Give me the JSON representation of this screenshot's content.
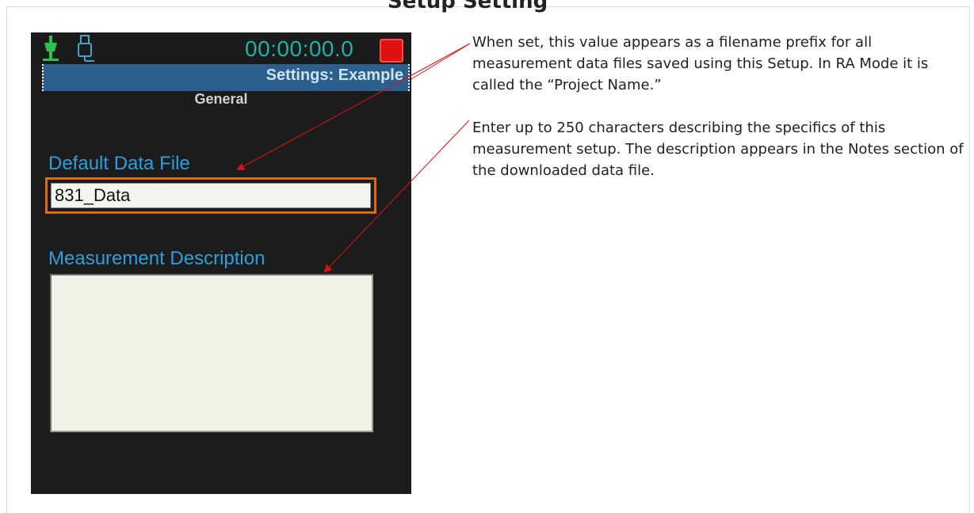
{
  "page": {
    "heading": "Setup Setting"
  },
  "device": {
    "clock": "00:00:00.0",
    "settings_title": "Settings: Example",
    "tab": "General",
    "default_data_file": {
      "label": "Default Data File",
      "value": "831_Data"
    },
    "measurement_description": {
      "label": "Measurement Description",
      "value": ""
    }
  },
  "annotations": {
    "default_data_file": "When set, this value appears as a filename prefix for all measurement data files saved using this Setup. In RA Mode it is called the “Project Name.”",
    "measurement_description": "Enter up to 250 characters describing the specifics of this measurement setup. The description appears in the Notes section of the downloaded data file."
  },
  "colors": {
    "accent_label": "#2c9fdc",
    "focus_border": "#e06a10",
    "arrow": "#e01010",
    "clock": "#20b2aa"
  },
  "icons": [
    "power-plug-icon",
    "usb-icon",
    "stop-record-icon"
  ]
}
